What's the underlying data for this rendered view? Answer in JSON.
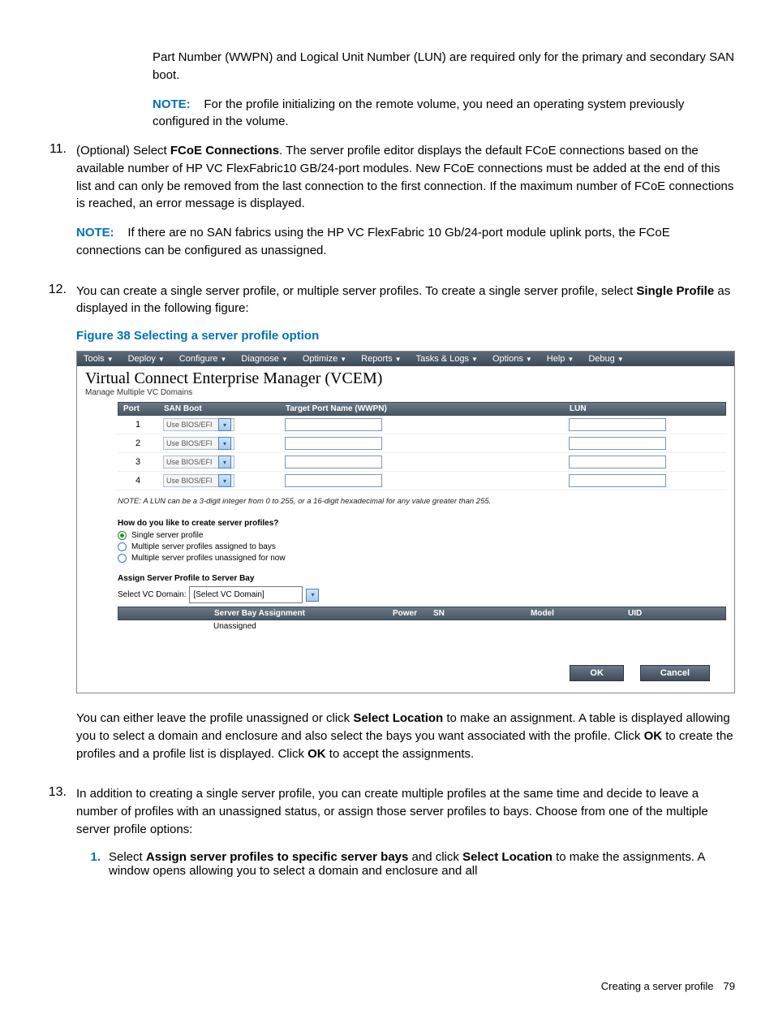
{
  "intro": {
    "p1": "Part Number (WWPN) and Logical Unit Number (LUN) are required only for the primary and secondary SAN boot.",
    "note_label": "NOTE:",
    "note_text": "For the profile initializing on the remote volume, you need an operating system previously configured in the volume."
  },
  "step11": {
    "num": "11.",
    "prefix": "(Optional) Select ",
    "bold": "FCoE Connections",
    "rest": ". The server profile editor displays the default FCoE connections based on the available number of HP VC FlexFabric10 GB/24-port modules. New FCoE connections must be added at the end of this list and can only be removed from the last connection to the first connection. If the maximum number of FCoE connections is reached, an error message is displayed.",
    "note_label": "NOTE:",
    "note_text": "If there are no SAN fabrics using the HP VC FlexFabric 10 Gb/24-port module uplink ports, the FCoE connections can be configured as unassigned."
  },
  "step12": {
    "num": "12.",
    "text_a": "You can create a single server profile, or multiple server profiles. To create a single server profile, select ",
    "bold": "Single Profile",
    "text_b": " as displayed in the following figure:",
    "fig_caption": "Figure 38 Selecting a server profile option",
    "after_a": "You can either leave the profile unassigned or click ",
    "after_bold1": "Select Location",
    "after_b": " to make an assignment. A table is displayed allowing you to select a domain and enclosure and also select the bays you want associated with the profile. Click ",
    "after_bold2": "OK",
    "after_c": " to create the profiles and a profile list is displayed. Click ",
    "after_bold3": "OK",
    "after_d": " to accept the assignments."
  },
  "figure": {
    "menus": [
      "Tools",
      "Deploy",
      "Configure",
      "Diagnose",
      "Optimize",
      "Reports",
      "Tasks & Logs",
      "Options",
      "Help",
      "Debug"
    ],
    "title": "Virtual Connect Enterprise Manager (VCEM)",
    "subtitle": "Manage Multiple VC Domains",
    "port_headers": {
      "port": "Port",
      "san": "SAN Boot",
      "target": "Target Port Name (WWPN)",
      "lun": "LUN"
    },
    "ports": [
      {
        "n": "1",
        "boot": "Use BIOS/EFI"
      },
      {
        "n": "2",
        "boot": "Use BIOS/EFI"
      },
      {
        "n": "3",
        "boot": "Use BIOS/EFI"
      },
      {
        "n": "4",
        "boot": "Use BIOS/EFI"
      }
    ],
    "lun_note": "NOTE: A LUN can be a 3-digit integer from 0 to 255, or a 16-digit hexadecimal for any value greater than 255.",
    "question": "How do you like to create server profiles?",
    "radios": [
      "Single server profile",
      "Multiple server profiles assigned to bays",
      "Multiple server profiles unassigned for now"
    ],
    "assign_title": "Assign Server Profile to Server Bay",
    "domain_label": "Select VC Domain:",
    "domain_value": "[Select VC Domain]",
    "assign_headers": {
      "sba": "Server Bay Assignment",
      "pwr": "Power",
      "sn": "SN",
      "mdl": "Model",
      "uid": "UID"
    },
    "assign_row": "Unassigned",
    "ok": "OK",
    "cancel": "Cancel"
  },
  "step13": {
    "num": "13.",
    "text": "In addition to creating a single server profile, you can create multiple profiles at the same time and decide to leave a number of profiles with an unassigned status, or assign those server profiles to bays. Choose from one of the multiple server profile options:",
    "sub1_num": "1.",
    "sub1_a": "Select ",
    "sub1_bold1": "Assign server profiles to specific server bays",
    "sub1_b": " and click ",
    "sub1_bold2": "Select Location",
    "sub1_c": " to make the assignments. A window opens allowing you to select a domain and enclosure and all"
  },
  "footer": {
    "text": "Creating a server profile",
    "page": "79"
  }
}
